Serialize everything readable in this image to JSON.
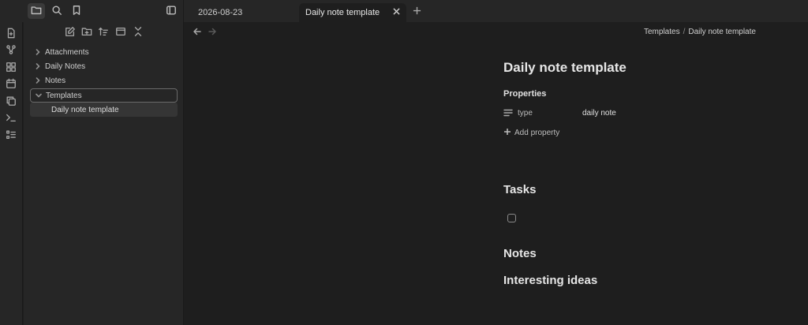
{
  "tabs": [
    {
      "label": "2026-08-23"
    },
    {
      "label": "Daily note template"
    }
  ],
  "sidebar": {
    "folders": [
      {
        "label": "Attachments"
      },
      {
        "label": "Daily Notes"
      },
      {
        "label": "Notes"
      },
      {
        "label": "Templates"
      }
    ],
    "file": {
      "label": "Daily note template"
    }
  },
  "breadcrumb": {
    "parent": "Templates",
    "separator": "/",
    "current": "Daily note template"
  },
  "note": {
    "title": "Daily note template",
    "properties_heading": "Properties",
    "properties": [
      {
        "key": "type",
        "value": "daily note"
      }
    ],
    "add_property": "Add property",
    "headings": {
      "tasks": "Tasks",
      "notes": "Notes",
      "ideas": "Interesting ideas"
    }
  }
}
